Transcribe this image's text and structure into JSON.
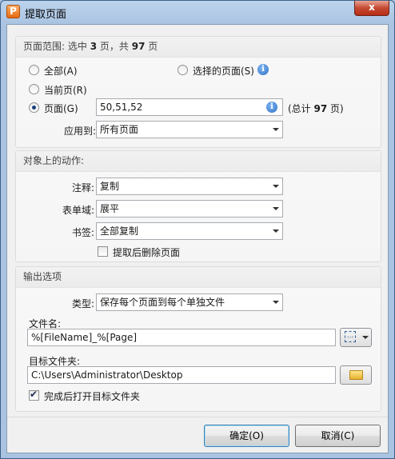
{
  "window": {
    "title": "提取页面",
    "app_icon_letter": "P",
    "close_symbol": "x"
  },
  "page_range": {
    "header_prefix": "页面范围: 选中",
    "selected_count": "3",
    "header_mid": "页，共",
    "total_count": "97",
    "header_suffix": "页",
    "all_label": "全部(A)",
    "selected_pages_label": "选择的页面(S)",
    "current_page_label": "当前页(R)",
    "pages_label": "页面(G)",
    "pages_value": "50,51,52",
    "total_prefix": "(总计",
    "total_value": "97",
    "total_suffix": "页)",
    "apply_to_label": "应用到:",
    "apply_to_value": "所有页面",
    "selected_option": "pages"
  },
  "actions": {
    "header": "对象上的动作:",
    "annotations_label": "注释:",
    "annotations_value": "复制",
    "form_fields_label": "表单域:",
    "form_fields_value": "展平",
    "bookmarks_label": "书签:",
    "bookmarks_value": "全部复制",
    "delete_after_label": "提取后删除页面",
    "delete_after_checked": false
  },
  "output": {
    "header": "输出选项",
    "type_label": "类型:",
    "type_value": "保存每个页面到每个单独文件",
    "filename_label": "文件名:",
    "filename_value": "%[FileName]_%[Page]",
    "folder_label": "目标文件夹:",
    "folder_value": "C:\\Users\\Administrator\\Desktop",
    "open_folder_label": "完成后打开目标文件夹",
    "open_folder_checked": true
  },
  "buttons": {
    "ok": "确定(O)",
    "cancel": "取消(C)"
  }
}
